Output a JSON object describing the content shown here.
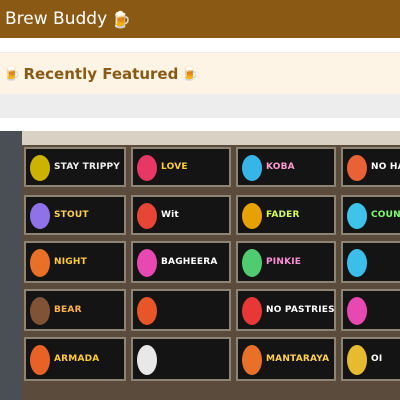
{
  "app_bar": {
    "title": "Brew Buddy",
    "icon": "beer-mug-icon"
  },
  "section": {
    "title": "Recently Featured",
    "icon": "beer-mug-icon"
  },
  "featured_image": {
    "description_alt": "Chalkboard beer menu wall",
    "boards": [
      {
        "label": "STAY TRIPPY",
        "color": "#f0f0f0",
        "accent": "#e0c400"
      },
      {
        "label": "LOVE",
        "color": "#ffcc33",
        "accent": "#ff3b6b"
      },
      {
        "label": "KOBA",
        "color": "#ff9bd1",
        "accent": "#38c6ff"
      },
      {
        "label": "NO HA",
        "color": "#ffffff",
        "accent": "#ff6a3a"
      },
      {
        "label": "STOUT",
        "color": "#ffd24d",
        "accent": "#9c7cff"
      },
      {
        "label": "Wit",
        "color": "#ffffff",
        "accent": "#ff4a3a"
      },
      {
        "label": "FADER",
        "color": "#d6ff57",
        "accent": "#ffb000"
      },
      {
        "label": "COUNT",
        "color": "#7dff6b",
        "accent": "#43d7ff"
      },
      {
        "label": "NIGHT",
        "color": "#ffcc33",
        "accent": "#ff7a2a"
      },
      {
        "label": "BAGHEERA",
        "color": "#ffffff",
        "accent": "#ff4ec2"
      },
      {
        "label": "PINKIE",
        "color": "#ff8fd6",
        "accent": "#57e07a"
      },
      {
        "label": "",
        "color": "#ffffff",
        "accent": "#3fd0ff"
      },
      {
        "label": "BEAR",
        "color": "#ffb34d",
        "accent": "#8d5a3a"
      },
      {
        "label": "",
        "color": "#ffffff",
        "accent": "#ff5c2a"
      },
      {
        "label": "NO PASTRIES",
        "color": "#ffffff",
        "accent": "#ff3b3b"
      },
      {
        "label": "",
        "color": "#ffffff",
        "accent": "#ff4ec2"
      },
      {
        "label": "ARMADA",
        "color": "#ffcc33",
        "accent": "#ff6a2a"
      },
      {
        "label": "",
        "color": "#ffffff",
        "accent": "#ffffff"
      },
      {
        "label": "MANTARAYA",
        "color": "#ffd24d",
        "accent": "#ff7a2a"
      },
      {
        "label": "OI",
        "color": "#ffffff",
        "accent": "#ffcc33"
      }
    ]
  }
}
